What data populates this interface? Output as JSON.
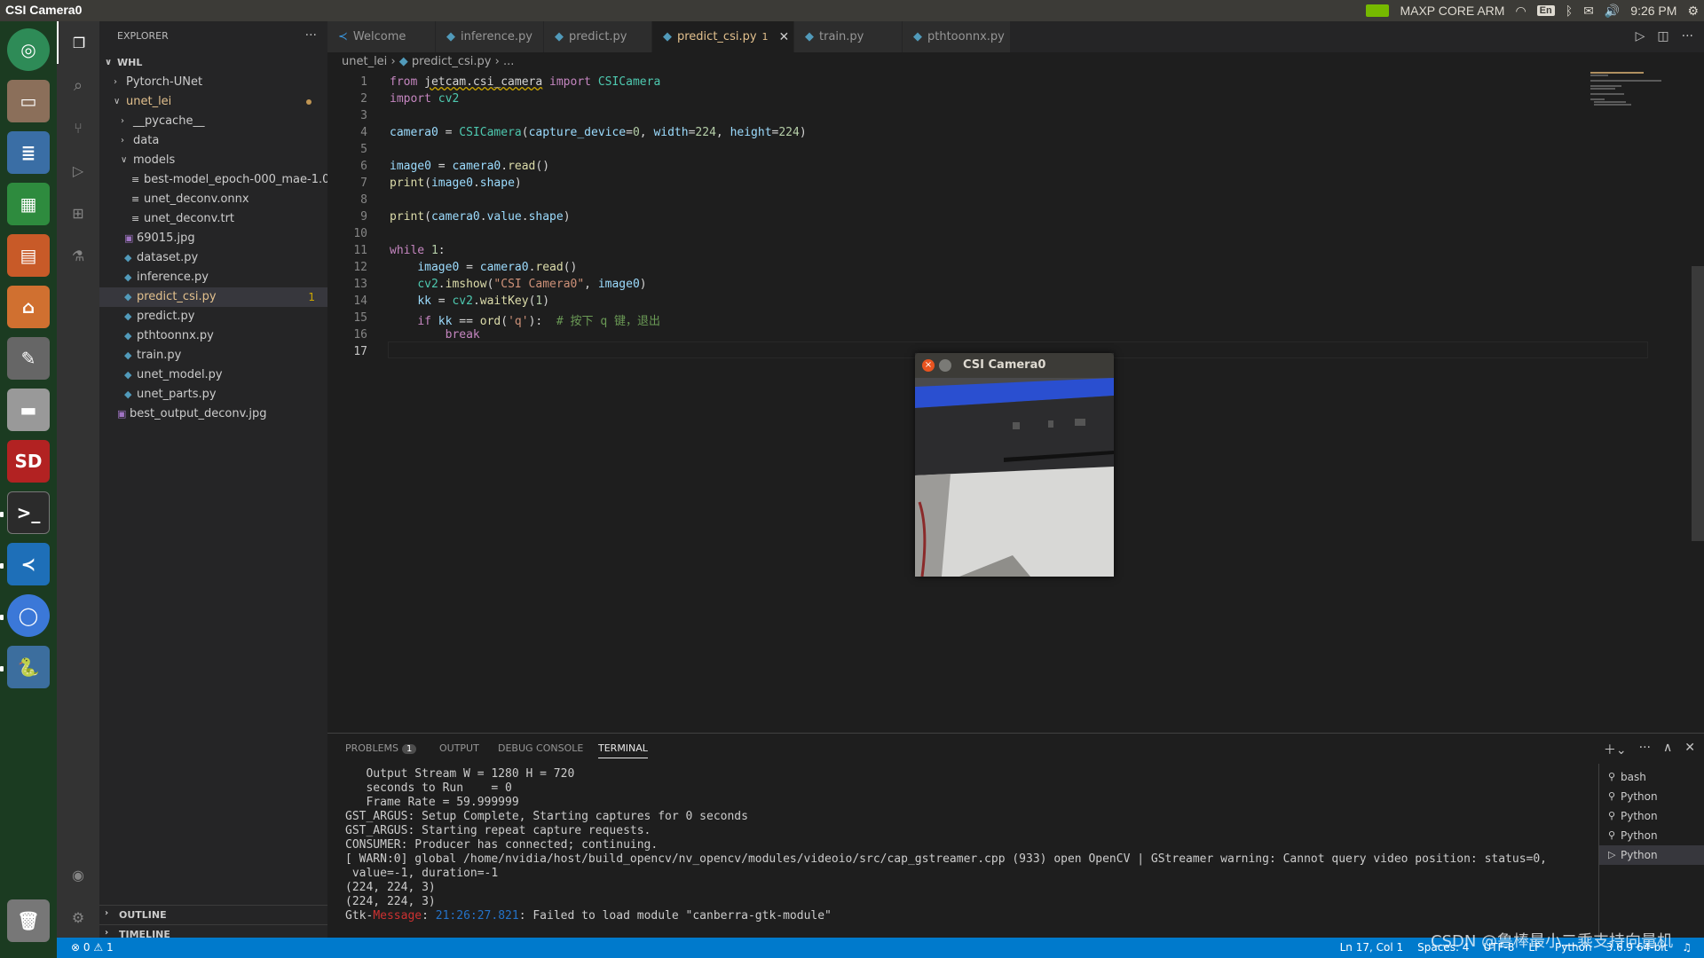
{
  "topbar": {
    "title": "CSI Camera0",
    "power_mode": "MAXP CORE ARM",
    "lang": "En",
    "time": "9:26 PM"
  },
  "dock": {
    "items": [
      "ubuntu-home",
      "files",
      "writer",
      "calc",
      "impress",
      "software",
      "settings",
      "drive",
      "sd-card",
      "terminal",
      "vscode",
      "chromium",
      "python",
      "trash"
    ]
  },
  "sidebar": {
    "title": "EXPLORER",
    "more": "···",
    "root": "WHL",
    "tree": [
      {
        "label": "Pytorch-UNet",
        "type": "folder",
        "depth": 1,
        "open": false
      },
      {
        "label": "unet_lei",
        "type": "folder",
        "depth": 1,
        "open": true,
        "modified": true
      },
      {
        "label": "__pycache__",
        "type": "folder",
        "depth": 2,
        "open": false
      },
      {
        "label": "data",
        "type": "folder",
        "depth": 2,
        "open": false
      },
      {
        "label": "models",
        "type": "folder",
        "depth": 2,
        "open": true
      },
      {
        "label": "best-model_epoch-000_mae-1.0...",
        "type": "file",
        "depth": 3,
        "icon": "≡"
      },
      {
        "label": "unet_deconv.onnx",
        "type": "file",
        "depth": 3,
        "icon": "≡"
      },
      {
        "label": "unet_deconv.trt",
        "type": "file",
        "depth": 3,
        "icon": "≡"
      },
      {
        "label": "69015.jpg",
        "type": "image",
        "depth": 2
      },
      {
        "label": "dataset.py",
        "type": "py",
        "depth": 2
      },
      {
        "label": "inference.py",
        "type": "py",
        "depth": 2
      },
      {
        "label": "predict_csi.py",
        "type": "py",
        "depth": 2,
        "selected": true,
        "badge": "1"
      },
      {
        "label": "predict.py",
        "type": "py",
        "depth": 2
      },
      {
        "label": "pthtoonnx.py",
        "type": "py",
        "depth": 2
      },
      {
        "label": "train.py",
        "type": "py",
        "depth": 2
      },
      {
        "label": "unet_model.py",
        "type": "py",
        "depth": 2
      },
      {
        "label": "unet_parts.py",
        "type": "py",
        "depth": 2
      },
      {
        "label": "best_output_deconv.jpg",
        "type": "image",
        "depth": 1
      }
    ],
    "outline": "OUTLINE",
    "timeline": "TIMELINE"
  },
  "tabs": [
    {
      "label": "Welcome",
      "icon": "vscode"
    },
    {
      "label": "inference.py",
      "icon": "py"
    },
    {
      "label": "predict.py",
      "icon": "py"
    },
    {
      "label": "predict_csi.py",
      "icon": "py",
      "active": true,
      "badge": "1"
    },
    {
      "label": "train.py",
      "icon": "py"
    },
    {
      "label": "pthtoonnx.py",
      "icon": "py"
    }
  ],
  "breadcrumb": {
    "folder": "unet_lei",
    "file": "predict_csi.py",
    "rest": "..."
  },
  "editor": {
    "current_line": "17",
    "lines": [
      {
        "n": "1",
        "html": "<span class='k'>from</span> <span class='sq'>jetcam.csi_camera</span> <span class='k'>import</span> <span class='c'>CSICamera</span>"
      },
      {
        "n": "2",
        "html": "<span class='k'>import</span> <span class='c'>cv2</span>"
      },
      {
        "n": "3",
        "html": ""
      },
      {
        "n": "4",
        "html": "<span class='v'>camera0</span> = <span class='c'>CSICamera</span>(<span class='v'>capture_device</span>=<span class='n'>0</span>, <span class='v'>width</span>=<span class='n'>224</span>, <span class='v'>height</span>=<span class='n'>224</span>)"
      },
      {
        "n": "5",
        "html": ""
      },
      {
        "n": "6",
        "html": "<span class='v'>image0</span> = <span class='v'>camera0</span>.<span class='f'>read</span>()"
      },
      {
        "n": "7",
        "html": "<span class='f'>print</span>(<span class='v'>image0</span>.<span class='v'>shape</span>)"
      },
      {
        "n": "8",
        "html": ""
      },
      {
        "n": "9",
        "html": "<span class='f'>print</span>(<span class='v'>camera0</span>.<span class='v'>value</span>.<span class='v'>shape</span>)"
      },
      {
        "n": "10",
        "html": ""
      },
      {
        "n": "11",
        "html": "<span class='k'>while</span> <span class='n'>1</span>:"
      },
      {
        "n": "12",
        "html": "    <span class='v'>image0</span> = <span class='v'>camera0</span>.<span class='f'>read</span>()"
      },
      {
        "n": "13",
        "html": "    <span class='c'>cv2</span>.<span class='f'>imshow</span>(<span class='s'>\"CSI Camera0\"</span>, <span class='v'>image0</span>)"
      },
      {
        "n": "14",
        "html": "    <span class='v'>kk</span> = <span class='c'>cv2</span>.<span class='f'>waitKey</span>(<span class='n'>1</span>)"
      },
      {
        "n": "15",
        "html": "    <span class='k'>if</span> <span class='v'>kk</span> == <span class='f'>ord</span>(<span class='s'>'q'</span>):  <span class='cm'># 按下 q 键，退出</span>"
      },
      {
        "n": "16",
        "html": "        <span class='k'>break</span>"
      },
      {
        "n": "17",
        "html": ""
      }
    ]
  },
  "camera_window": {
    "title": "CSI Camera0"
  },
  "panel": {
    "tabs": [
      {
        "label": "PROBLEMS",
        "badge": "1"
      },
      {
        "label": "OUTPUT"
      },
      {
        "label": "DEBUG CONSOLE"
      },
      {
        "label": "TERMINAL",
        "active": true
      }
    ],
    "terminal_lines": [
      "   Output Stream W = 1280 H = 720",
      "   seconds to Run    = 0",
      "   Frame Rate = 59.999999",
      "GST_ARGUS: Setup Complete, Starting captures for 0 seconds",
      "GST_ARGUS: Starting repeat capture requests.",
      "CONSUMER: Producer has connected; continuing.",
      "[ WARN:0] global /home/nvidia/host/build_opencv/nv_opencv/modules/videoio/src/cap_gstreamer.cpp (933) open OpenCV | GStreamer warning: Cannot query video position: status=0,",
      " value=-1, duration=-1",
      "(224, 224, 3)",
      "(224, 224, 3)"
    ],
    "gtk_prefix": "Gtk-",
    "gtk_word": "Message",
    "gtk_time": "21:26:27.821",
    "gtk_msg": ": Failed to load module \"canberra-gtk-module\"",
    "terminals": [
      "bash",
      "Python",
      "Python",
      "Python",
      "Python"
    ]
  },
  "status": {
    "errors": "0",
    "warnings": "1",
    "position": "Ln 17, Col 1",
    "spaces": "Spaces: 4",
    "encoding": "UTF-8",
    "eol": "LF",
    "language": "Python",
    "interpreter": "3.6.9 64-bit"
  },
  "watermark": "CSDN @鲁棒最小二乘支持向量机"
}
